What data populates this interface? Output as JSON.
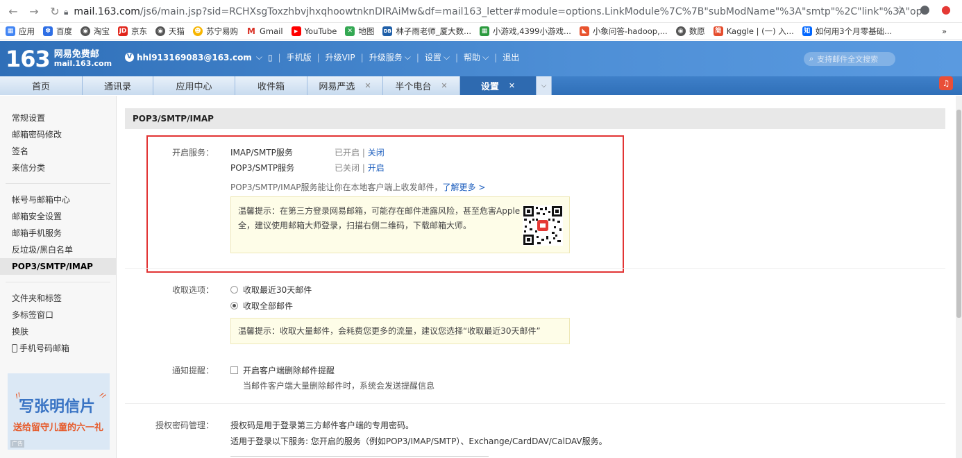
{
  "browser": {
    "url_host": "mail.163.com",
    "url_path": "/js6/main.jsp?sid=RCHXsgToxzhbvjhxqhoowtnknDIRAiMw&df=mail163_letter#module=options.LinkModule%7C%7B\"subModName\"%3A\"smtp\"%2C\"link\"%3A\"option_pop3\"%...",
    "bookmarks": [
      "应用",
      "百度",
      "淘宝",
      "京东",
      "天猫",
      "苏宁易购",
      "Gmail",
      "YouTube",
      "地图",
      "林子雨老师_厦大数...",
      "小游戏,4399小游戏...",
      "小象问答-hadoop,...",
      "数愿",
      "Kaggle | (一) 入...",
      "如何用3个月零基础..."
    ],
    "more": "»"
  },
  "header": {
    "logo_num": "163",
    "logo_name": "网易免费邮",
    "logo_domain": "mail.163.com",
    "email": "hhl913169083@163.com",
    "links": [
      "手机版",
      "升级VIP",
      "升级服务",
      "设置",
      "帮助",
      "退出"
    ],
    "search_placeholder": "支持邮件全文搜索"
  },
  "tabs": [
    "首页",
    "通讯录",
    "应用中心",
    "收件箱",
    "网易严选",
    "半个电台",
    "设置"
  ],
  "sidebar": {
    "group1": [
      "常规设置",
      "邮箱密码修改",
      "签名",
      "来信分类"
    ],
    "group2": [
      "帐号与邮箱中心",
      "邮箱安全设置",
      "邮箱手机服务",
      "反垃圾/黑白名单",
      "POP3/SMTP/IMAP"
    ],
    "group3": [
      "文件夹和标签",
      "多标签窗口",
      "换肤",
      "手机号码邮箱"
    ],
    "banner_big": "写张明信片",
    "banner_small": "送给留守儿童的六一礼",
    "banner_ad": "广告"
  },
  "main": {
    "title": "POP3/SMTP/IMAP",
    "service_label": "开启服务：",
    "imap_name": "IMAP/SMTP服务",
    "imap_status": "已开启",
    "imap_action": "关闭",
    "pop3_name": "POP3/SMTP服务",
    "pop3_status": "已关闭",
    "pop3_action": "开启",
    "sep": "|",
    "desc": "POP3/SMTP/IMAP服务能让你在本地客户端上收发邮件，",
    "learn_more": "了解更多 >",
    "tip1_line1": "温馨提示：在第三方登录网易邮箱，可能存在邮件泄露风险，甚至危害Apple ID安",
    "tip1_line2": "全，建议使用邮箱大师登录，扫描右侧二维码，下载邮箱大师。",
    "receive_label": "收取选项：",
    "receive_opt1": "收取最近30天邮件",
    "receive_opt2": "收取全部邮件",
    "receive_selected": "收取全部邮件",
    "tip2": "温馨提示：收取大量邮件，会耗费您更多的流量，建议您选择“收取最近30天邮件”",
    "notify_label": "通知提醒：",
    "notify_check": "开启客户端删除邮件提醒",
    "notify_checked": false,
    "notify_desc": "当邮件客户端大量删除邮件时，系统会发送提醒信息",
    "auth_label": "授权密码管理：",
    "auth_line1": "授权码是用于登录第三方邮件客户端的专用密码。",
    "auth_line2": "适用于登录以下服务: 您开启的服务（例如POP3/IMAP/SMTP）、Exchange/CardDAV/CalDAV服务。"
  },
  "colors": {
    "header_blue": "#2f6fb8",
    "link_blue": "#1a5cbd",
    "highlight_red": "#e23434",
    "tip_bg": "#fefde8"
  }
}
